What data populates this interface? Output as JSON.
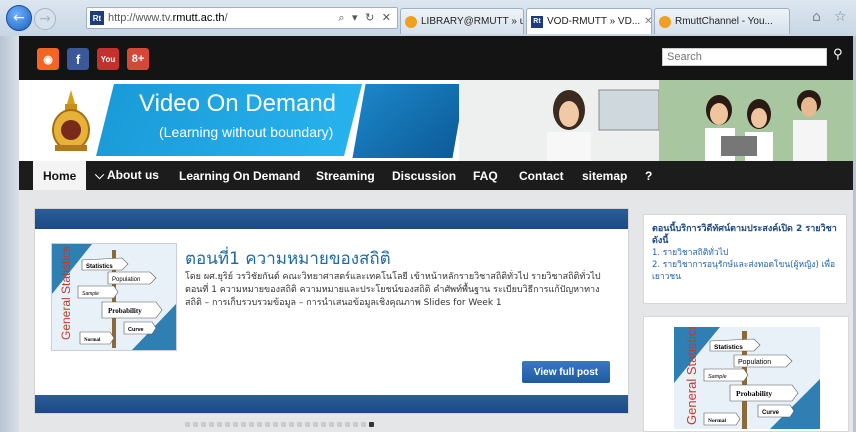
{
  "browser": {
    "url_prefix": "http://www.tv.",
    "url_domain": "rmutt.ac.th",
    "url_suffix": "/",
    "address_tools": "⌕ ▾ ↻ ✕",
    "tabs": [
      {
        "label": "LIBRARY@RMUTT » u...",
        "icon_color": "#f0a020"
      },
      {
        "label": "VOD-RMUTT » VD...",
        "icon_color": "#1c3d7a",
        "icon_text": "Rt"
      },
      {
        "label": "RmuttChannel - You...",
        "icon_color": "#f0a020"
      }
    ],
    "fav_text": "Rt"
  },
  "site": {
    "social": [
      {
        "name": "rss",
        "label": "◉",
        "color": "#f26522"
      },
      {
        "name": "facebook",
        "label": "f",
        "color": "#3b5998"
      },
      {
        "name": "youtube",
        "label": "You",
        "color": "#c4302b"
      },
      {
        "name": "googleplus",
        "label": "8+",
        "color": "#d34836"
      }
    ],
    "search_placeholder": "Search",
    "banner": {
      "title": "Video On Demand",
      "subtitle": "(Learning without boundary)"
    },
    "nav": [
      {
        "label": "Home"
      },
      {
        "label": "⌵ About us"
      },
      {
        "label": "Learning On Demand"
      },
      {
        "label": "Streaming"
      },
      {
        "label": "Discussion"
      },
      {
        "label": "FAQ"
      },
      {
        "label": "Contact"
      },
      {
        "label": "sitemap"
      },
      {
        "label": "?"
      }
    ],
    "post": {
      "title": "ตอนที่1 ความหมายของสถิติ",
      "body": "โดย ผศ.ยุริย์ วรวิชัยกันต์ คณะวิทยาศาสตร์และเทคโนโลยี เข้าหน้าหลักรายวิชาสถิติทั่วไป รายวิชาสถิติทั่วไป ตอนที่ 1 ความหมายของสถิติ ความหมายและประโยชน์ของสถิติ คำศัพท์พื้นฐาน ระเบียบวิธีการแก้ปัญหาทางสถิติ – การเก็บรวบรวมข้อมูล – การนำเสนอข้อมูลเชิงคุณภาพ  Slides for Week 1",
      "button": "View full post",
      "thumb": {
        "vertical": "General Statistics",
        "signs": [
          "Statistics",
          "Population",
          "Sample",
          "Probability",
          "Curve",
          "Normal"
        ]
      }
    },
    "sidebar": {
      "heading": "ตอนนี้บริการวิดีทัศน์ตามประสงค์เปิด 2 รายวิชาดังนี้",
      "links": [
        "1. รายวิชาสถิติทั่วไป",
        "2. รายวิชาการอนุรักษ์และส่งทอดโขน(ผู้หญิง) เพื่อเยาวชน"
      ]
    },
    "pager": {
      "count": 24,
      "active": 23
    }
  }
}
